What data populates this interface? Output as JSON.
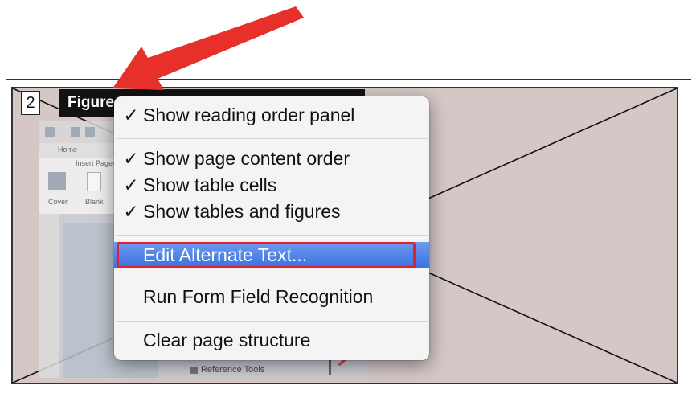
{
  "figure": {
    "order_number": "2",
    "tag_label": "Figure"
  },
  "thumbnail": {
    "home_tab": "Home",
    "insert_pages": "Insert Pages",
    "cover": "Cover",
    "blank": "Blank",
    "reference_tools": "Reference Tools"
  },
  "context_menu": {
    "items": [
      {
        "label": "Show reading order panel",
        "checked": "✓"
      },
      {
        "label": "Show page content order",
        "checked": "✓"
      },
      {
        "label": "Show table cells",
        "checked": "✓"
      },
      {
        "label": "Show tables and figures",
        "checked": "✓"
      },
      {
        "label": "Edit Alternate Text...",
        "checked": ""
      },
      {
        "label": "Run Form Field Recognition",
        "checked": ""
      },
      {
        "label": "Clear page structure",
        "checked": ""
      }
    ],
    "highlighted_item": "Edit Alternate Text..."
  },
  "colors": {
    "figure_fill": "#d4c7c6",
    "highlight": "#3a6fdf",
    "focus_outline": "#e0202a",
    "arrow": "#e8302a"
  },
  "icons": [
    "arrow-pointer-icon",
    "checkmark-icon"
  ]
}
